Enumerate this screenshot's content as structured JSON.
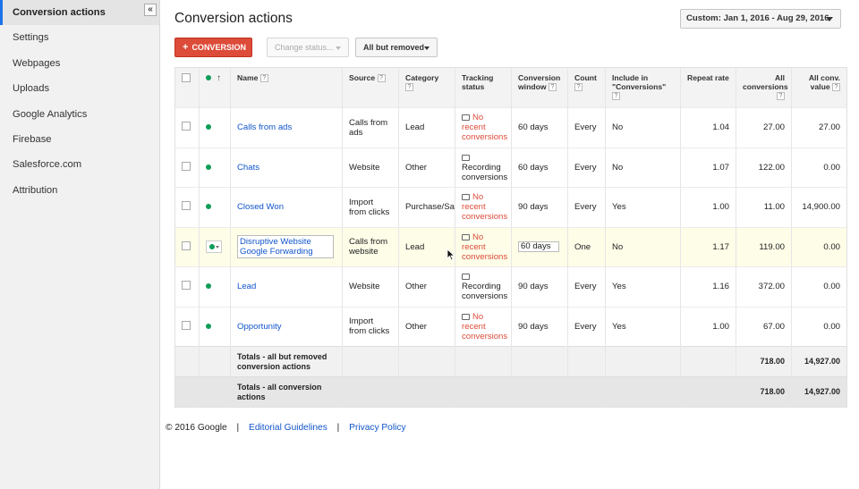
{
  "sidebar": {
    "items": [
      {
        "label": "Conversion actions",
        "active": true
      },
      {
        "label": "Settings"
      },
      {
        "label": "Webpages"
      },
      {
        "label": "Uploads"
      },
      {
        "label": "Google Analytics"
      },
      {
        "label": "Firebase"
      },
      {
        "label": "Salesforce.com"
      },
      {
        "label": "Attribution"
      }
    ],
    "collapse_glyph": "«"
  },
  "header": {
    "title": "Conversion actions",
    "date_range": "Custom: Jan 1, 2016 - Aug 29, 2016"
  },
  "toolbar": {
    "add_label": "CONVERSION",
    "status_label": "Change status...",
    "filter_label": "All but removed"
  },
  "table": {
    "columns": {
      "name": "Name",
      "source": "Source",
      "category": "Category",
      "tracking_1": "Tracking",
      "tracking_2": "status",
      "window_1": "Conversion",
      "window_2": "window",
      "count": "Count",
      "include_1": "Include in",
      "include_2": "\"Conversions\"",
      "repeat": "Repeat rate",
      "all_1": "All",
      "all_2": "conversions",
      "allval_1": "All conv.",
      "allval_2": "value"
    },
    "help_glyph": "?",
    "sort_glyph": "↑",
    "rows": [
      {
        "name_1": "Calls from ads",
        "name_2": "",
        "source_1": "Calls from",
        "source_2": "ads",
        "category": "Lead",
        "status_1": "No",
        "status_2": "recent",
        "status_3": "conversions",
        "status_type": "warn",
        "window": "60 days",
        "count": "Every",
        "include": "No",
        "repeat": "1.04",
        "all_conv": "27.00",
        "all_value": "27.00"
      },
      {
        "name_1": "Chats",
        "name_2": "",
        "source_1": "Website",
        "source_2": "",
        "category": "Other",
        "status_1": "",
        "status_2": "Recording",
        "status_3": "conversions",
        "status_type": "ok",
        "window": "60 days",
        "count": "Every",
        "include": "No",
        "repeat": "1.07",
        "all_conv": "122.00",
        "all_value": "0.00"
      },
      {
        "name_1": "Closed Won",
        "name_2": "",
        "source_1": "Import",
        "source_2": "from clicks",
        "category": "Purchase/Sa",
        "status_1": "No",
        "status_2": "recent",
        "status_3": "conversions",
        "status_type": "warn",
        "window": "90 days",
        "count": "Every",
        "include": "Yes",
        "repeat": "1.00",
        "all_conv": "11.00",
        "all_value": "14,900.00"
      },
      {
        "name_1": "Disruptive Website",
        "name_2": "Google Forwarding",
        "source_1": "Calls from",
        "source_2": "website",
        "category": "Lead",
        "status_1": "No",
        "status_2": "recent",
        "status_3": "conversions",
        "status_type": "warn",
        "window": "60 days",
        "count": "One",
        "include": "No",
        "repeat": "1.17",
        "all_conv": "119.00",
        "all_value": "0.00",
        "editing": true
      },
      {
        "name_1": "Lead",
        "name_2": "",
        "source_1": "Website",
        "source_2": "",
        "category": "Other",
        "status_1": "",
        "status_2": "Recording",
        "status_3": "conversions",
        "status_type": "ok",
        "window": "90 days",
        "count": "Every",
        "include": "Yes",
        "repeat": "1.16",
        "all_conv": "372.00",
        "all_value": "0.00"
      },
      {
        "name_1": "Opportunity",
        "name_2": "",
        "source_1": "Import",
        "source_2": "from clicks",
        "category": "Other",
        "status_1": "No",
        "status_2": "recent",
        "status_3": "conversions",
        "status_type": "warn",
        "window": "90 days",
        "count": "Every",
        "include": "Yes",
        "repeat": "1.00",
        "all_conv": "67.00",
        "all_value": "0.00"
      }
    ],
    "totals": [
      {
        "label_1": "Totals - all but removed",
        "label_2": "conversion actions",
        "all_conv": "718.00",
        "all_value": "14,927.00"
      },
      {
        "label_1": "Totals - all conversion",
        "label_2": "actions",
        "all_conv": "718.00",
        "all_value": "14,927.00"
      }
    ]
  },
  "footer": {
    "copyright": "© 2016 Google",
    "separator": "|",
    "links": [
      "Editorial Guidelines",
      "Privacy Policy"
    ]
  },
  "colors": {
    "accent": "#dd4b39",
    "link": "#1155cc",
    "status_dot": "#0f9d58"
  }
}
